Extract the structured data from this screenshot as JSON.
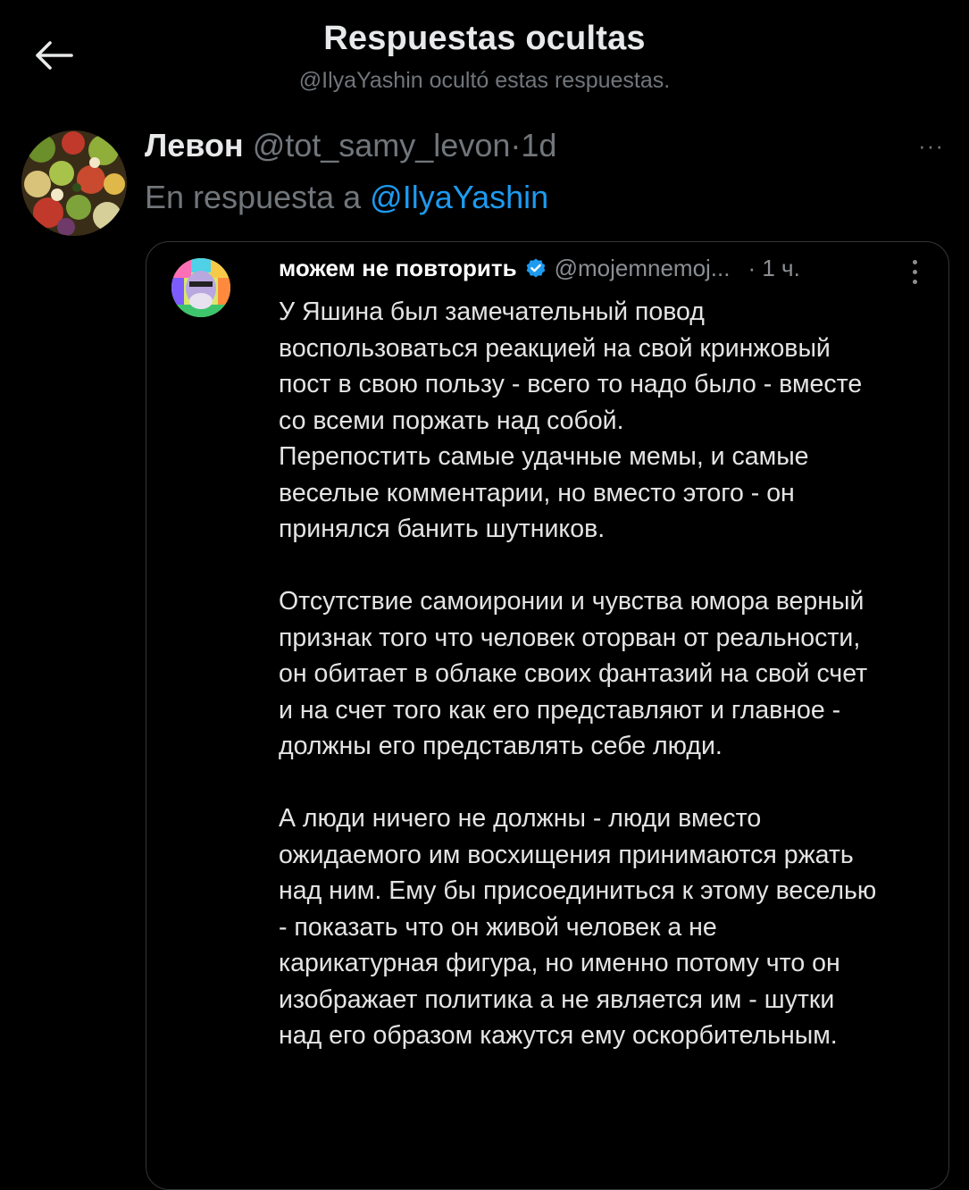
{
  "header": {
    "back_icon": "arrow-left-icon",
    "title": "Respuestas ocultas",
    "subtitle": "@IlyaYashin ocultó estas respuestas."
  },
  "tweet": {
    "author_name": "Левон",
    "author_handle": "@tot_samy_levon",
    "separator": "·",
    "time": "1d",
    "more_icon": "more-horizontal-icon",
    "more_label": "···",
    "reply_prefix": "En respuesta a",
    "reply_mention": "@IlyaYashin"
  },
  "quoted": {
    "author_name": "можем не повторить",
    "verified_icon": "verified-badge-icon",
    "author_handle": "@mojemnemoj...",
    "time": "· 1 ч.",
    "more_icon": "more-vertical-icon",
    "paragraphs": [
      [
        "У Яшина был замечательный повод",
        "воспользоваться реакцией на свой кринжовый",
        "пост в свою пользу - всего то надо было - вместе",
        "со всеми поржать над собой.",
        "Перепостить самые удачные мемы, и самые",
        "веселые комментарии, но вместо этого - он",
        "принялся банить шутников."
      ],
      [
        "Отсутствие самоиронии и чувства юмора верный",
        "признак того что человек оторван от реальности,",
        "он обитает в облаке своих фантазий на свой счет",
        "и на счет того как его представляют и главное -",
        "должны его представлять себе люди."
      ],
      [
        "А люди ничего не должны - люди вместо",
        "ожидаемого им восхищения принимаются ржать",
        "над ним. Ему бы присоединиться к этому веселью",
        "- показать что он живой человек а не",
        "карикатурная фигура, но именно потому что он",
        "изображает политика а не является им - шутки",
        "над его образом кажутся ему оскорбительным."
      ]
    ]
  },
  "colors": {
    "background": "#000000",
    "text_primary": "#e7e9ea",
    "text_secondary": "#71767b",
    "link": "#1d9bf0",
    "verified": "#1d9bf0",
    "card_border": "#333639"
  }
}
